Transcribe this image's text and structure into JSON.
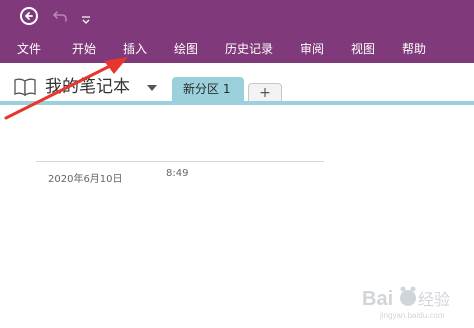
{
  "quick_access": {
    "back": "back-icon",
    "undo": "undo-icon",
    "customize": "chevron-down-icon"
  },
  "ribbon": {
    "tabs": [
      {
        "label": "文件"
      },
      {
        "label": "开始"
      },
      {
        "label": "插入"
      },
      {
        "label": "绘图"
      },
      {
        "label": "历史记录"
      },
      {
        "label": "审阅"
      },
      {
        "label": "视图"
      },
      {
        "label": "帮助"
      }
    ]
  },
  "notebook": {
    "name": "我的笔记本",
    "sections": [
      {
        "label": "新分区 1"
      }
    ],
    "add_section_label": "+"
  },
  "page": {
    "date": "2020年6月10日",
    "time": "8:49"
  },
  "annotation": {
    "arrow_color": "#e8362f"
  },
  "colors": {
    "ribbon": "#80397b",
    "section_tab": "#9bd1dd"
  }
}
